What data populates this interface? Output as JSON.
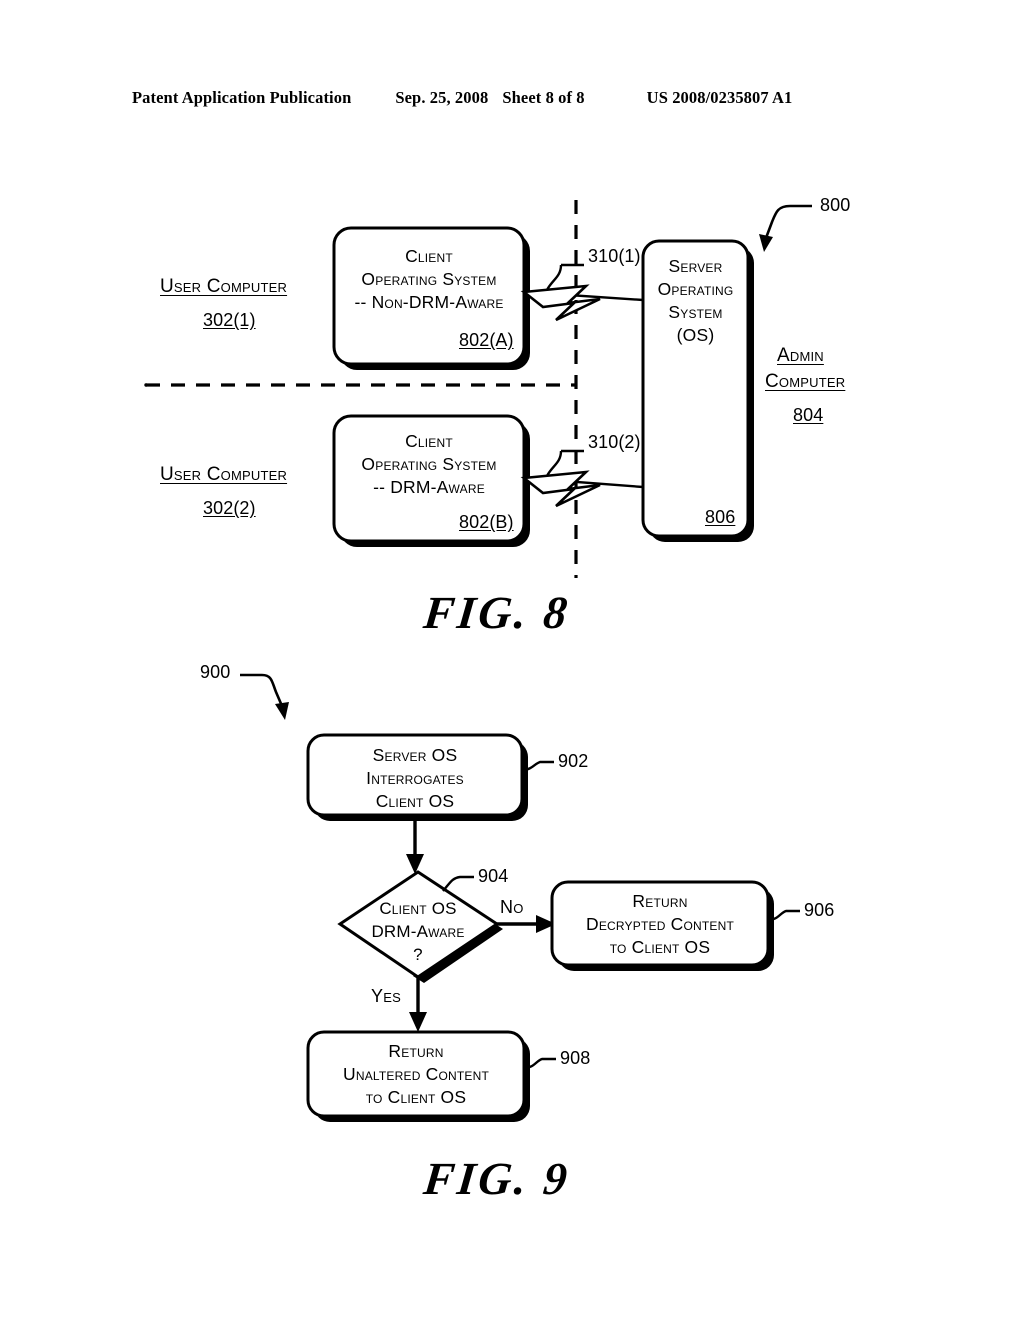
{
  "header": {
    "publication": "Patent Application Publication",
    "date": "Sep. 25, 2008",
    "sheet": "Sheet 8 of 8",
    "patent_number": "US 2008/0235807 A1"
  },
  "figure8": {
    "caption": "FIG. 8",
    "system_ref": "800",
    "user_computer_1": {
      "title": "User Computer",
      "ref": "302(1)"
    },
    "user_computer_2": {
      "title": "User Computer",
      "ref": "302(2)"
    },
    "client_os_a": {
      "line1": "Client",
      "line2": "Operating System",
      "line3": "--  Non-DRM-Aware",
      "ref": "802(A)"
    },
    "client_os_b": {
      "line1": "Client",
      "line2": "Operating System",
      "line3": "--  DRM-Aware",
      "ref": "802(B)"
    },
    "server_os": {
      "line1": "Server",
      "line2": "Operating",
      "line3": "System",
      "line4": "(OS)",
      "ref": "806"
    },
    "admin_computer": {
      "line1": "Admin",
      "line2": "Computer",
      "ref": "804"
    },
    "network_link_1": "310(1)",
    "network_link_2": "310(2)"
  },
  "figure9": {
    "caption": "FIG. 9",
    "process_ref": "900",
    "step_902": {
      "line1": "Server OS",
      "line2": "Interrogates",
      "line3": "Client OS",
      "ref": "902"
    },
    "decision_904": {
      "line1": "Client OS",
      "line2": "DRM-Aware",
      "line3": "?",
      "ref": "904"
    },
    "branch_no": "No",
    "branch_yes": "Yes",
    "step_906": {
      "line1": "Return",
      "line2": "Decrypted Content",
      "line3": "to Client OS",
      "ref": "906"
    },
    "step_908": {
      "line1": "Return",
      "line2": "Unaltered Content",
      "line3": "to Client OS",
      "ref": "908"
    }
  }
}
